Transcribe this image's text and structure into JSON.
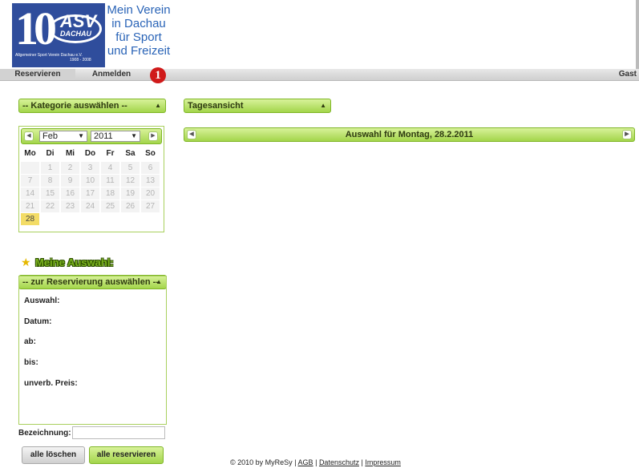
{
  "logo": {
    "number": "10",
    "abbrev": "ASV",
    "city": "DACHAU",
    "club_full": "Allgemeiner Sport Verein Dachau e.V.",
    "years": "1908 - 2008",
    "slogan_lines": [
      "Mein Verein",
      "in Dachau",
      "für Sport",
      "und Freizeit"
    ]
  },
  "nav": {
    "items": [
      {
        "label": "Reservieren",
        "active": true
      },
      {
        "label": "Anmelden",
        "active": false
      }
    ],
    "badge": "1",
    "user": "Gast"
  },
  "kategorie_select": {
    "label": "-- Kategorie auswählen --"
  },
  "ansicht_select": {
    "label": "Tagesansicht"
  },
  "auswahl_bar": {
    "label": "Auswahl für Montag, 28.2.2011"
  },
  "calendar": {
    "month": "Feb",
    "year": "2011",
    "prev_icon": "chevron-left-icon",
    "next_icon": "chevron-right-icon",
    "weekdays": [
      "Mo",
      "Di",
      "Mi",
      "Do",
      "Fr",
      "Sa",
      "So"
    ],
    "weeks": [
      [
        "",
        "1",
        "2",
        "3",
        "4",
        "5",
        "6"
      ],
      [
        "7",
        "8",
        "9",
        "10",
        "11",
        "12",
        "13"
      ],
      [
        "14",
        "15",
        "16",
        "17",
        "18",
        "19",
        "20"
      ],
      [
        "21",
        "22",
        "23",
        "24",
        "25",
        "26",
        "27"
      ],
      [
        "28",
        "",
        "",
        "",
        "",
        "",
        ""
      ]
    ],
    "selected_day": "28"
  },
  "meine_auswahl": {
    "title": "Meine Auswahl:",
    "reservation_select": "-- zur Reservierung auswählen --",
    "fields": [
      "Auswahl:",
      "Datum:",
      "ab:",
      "bis:",
      "unverb. Preis:"
    ],
    "bezeichnung_label": "Bezeichnung:",
    "bezeichnung_value": ""
  },
  "buttons": {
    "clear": "alle löschen",
    "reserve": "alle reservieren"
  },
  "footer": {
    "copyright": "© 2010 by MyReSy",
    "sep": "|",
    "links": [
      "AGB",
      "Datenschutz",
      "Impressum"
    ]
  },
  "colors": {
    "green_light": "#d8f29a",
    "green_dark": "#a3d54b",
    "green_border": "#7fb626",
    "logo_blue": "#2f4d9c",
    "slogan_blue": "#2a64b7",
    "badge_red": "#d01a1a",
    "selected_day": "#f3dc66"
  }
}
